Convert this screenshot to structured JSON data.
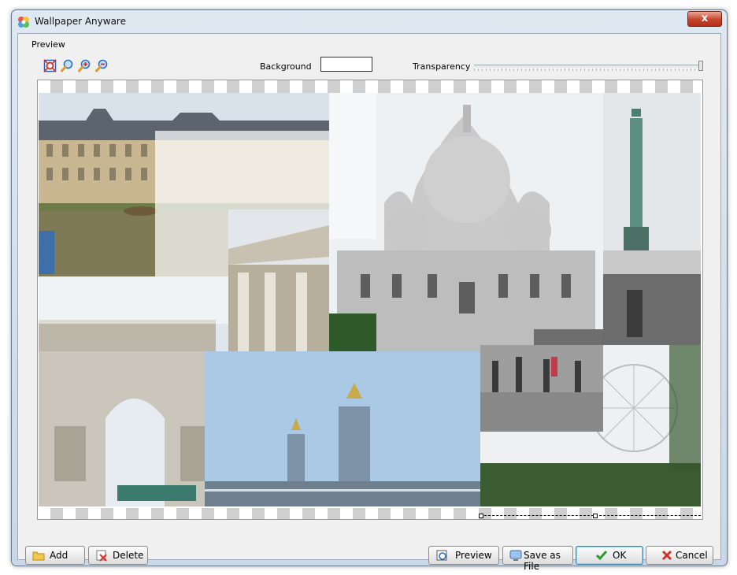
{
  "window": {
    "title": "Wallpaper Anyware",
    "close_label": "x"
  },
  "preview_group": {
    "label": "Preview"
  },
  "toolbar": {
    "tools": [
      {
        "icon": "fit-to-window-icon"
      },
      {
        "icon": "zoom-icon"
      },
      {
        "icon": "zoom-in-icon"
      },
      {
        "icon": "zoom-out-icon"
      }
    ],
    "background_label": "Background",
    "background_color": "#ffffff",
    "transparency_label": "Transparency",
    "transparency_level": 1.0
  },
  "collage": {
    "photos": [
      {
        "name": "luxembourg-palace-photo",
        "subject": "Luxembourg Palace"
      },
      {
        "name": "pantheon-photo",
        "subject": "Pantheon columns"
      },
      {
        "name": "sacre-coeur-photo",
        "subject": "Sacre-Coeur basilica"
      },
      {
        "name": "bastille-column-photo",
        "subject": "July Column, Place de la Bastille"
      },
      {
        "name": "arc-de-triomphe-photo",
        "subject": "Arc de Triomphe"
      },
      {
        "name": "pont-alexandre-photo",
        "subject": "Pont Alexandre III"
      },
      {
        "name": "ferris-wheel-photo",
        "subject": "Ferris wheel"
      },
      {
        "name": "steps-crowd-photo",
        "subject": "Crowd on steps"
      }
    ]
  },
  "buttons": {
    "add": "Add",
    "delete": "Delete",
    "preview": "Preview",
    "save_as_file": "Save as File",
    "ok": "OK",
    "cancel": "Cancel"
  },
  "colors": {
    "accent": "#3c7fb1",
    "close": "#c7432b",
    "sky": "#dfe7ef"
  }
}
